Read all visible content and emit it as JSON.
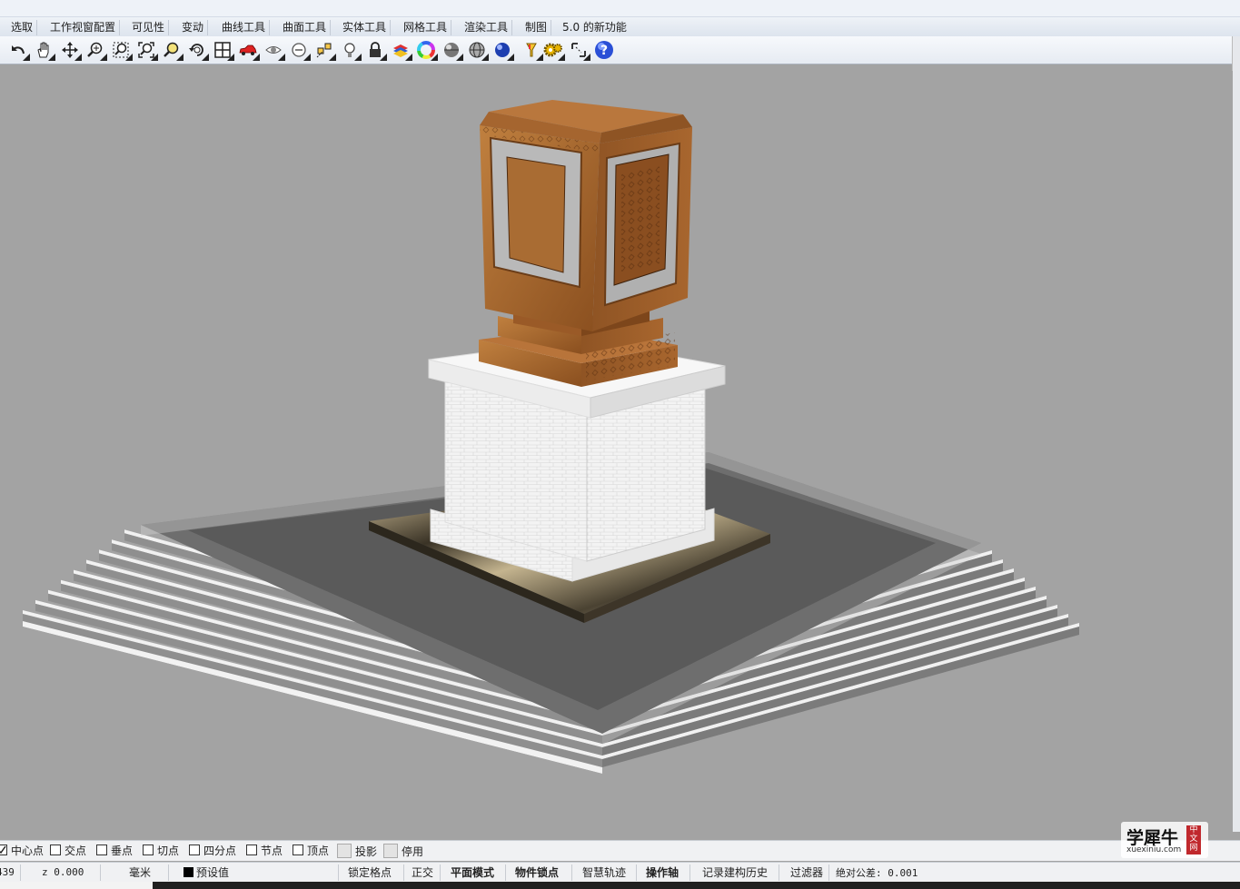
{
  "menu_tabs": [
    "选取",
    "工作视窗配置",
    "可见性",
    "变动",
    "曲线工具",
    "曲面工具",
    "实体工具",
    "网格工具",
    "渲染工具",
    "制图",
    "5.0 的新功能"
  ],
  "toolbar_icons": [
    "undo-icon",
    "pan-hand-icon",
    "move-view-icon",
    "zoom-icon",
    "zoom-window-icon",
    "zoom-extents-icon",
    "zoom-selected-icon",
    "rotate-view-icon",
    "four-viewports-icon",
    "car-icon",
    "hide-eye-icon",
    "show-object-icon",
    "select-points-icon",
    "light-bulb-icon",
    "lock-icon",
    "layer-palette-icon",
    "color-wheel-icon",
    "shaded-sphere-icon",
    "wireframe-sphere-icon",
    "rendered-sphere-icon",
    "highlighter-icon",
    "gear-settings-icon",
    "grid-snap-icon",
    "help-icon"
  ],
  "osnap": {
    "items": [
      {
        "label": "中心点",
        "checked": true
      },
      {
        "label": "交点",
        "checked": false
      },
      {
        "label": "垂点",
        "checked": false
      },
      {
        "label": "切点",
        "checked": false
      },
      {
        "label": "四分点",
        "checked": false
      },
      {
        "label": "节点",
        "checked": false
      },
      {
        "label": "顶点",
        "checked": false
      },
      {
        "label": "投影",
        "checked": false,
        "disabled": true
      },
      {
        "label": "停用",
        "checked": false,
        "disabled": true
      }
    ]
  },
  "status": {
    "coord_prefix": "439",
    "z": "z 0.000",
    "units": "毫米",
    "layer": "预设值",
    "grid_snap": "锁定格点",
    "ortho": "正交",
    "planar": "平面模式",
    "osnap": "物件锁点",
    "smarttrack": "智慧轨迹",
    "gumball": "操作轴",
    "history": "记录建构历史",
    "filter": "过滤器",
    "tolerance": "绝对公差: 0.001"
  },
  "watermark": {
    "text": "学犀牛",
    "url_text": "xuexiniu.com",
    "seal": "中文网"
  },
  "colors": {
    "viewport_bg": "#a3a3a3",
    "wood": "#b36e35",
    "stone": "#f2f2f2"
  }
}
